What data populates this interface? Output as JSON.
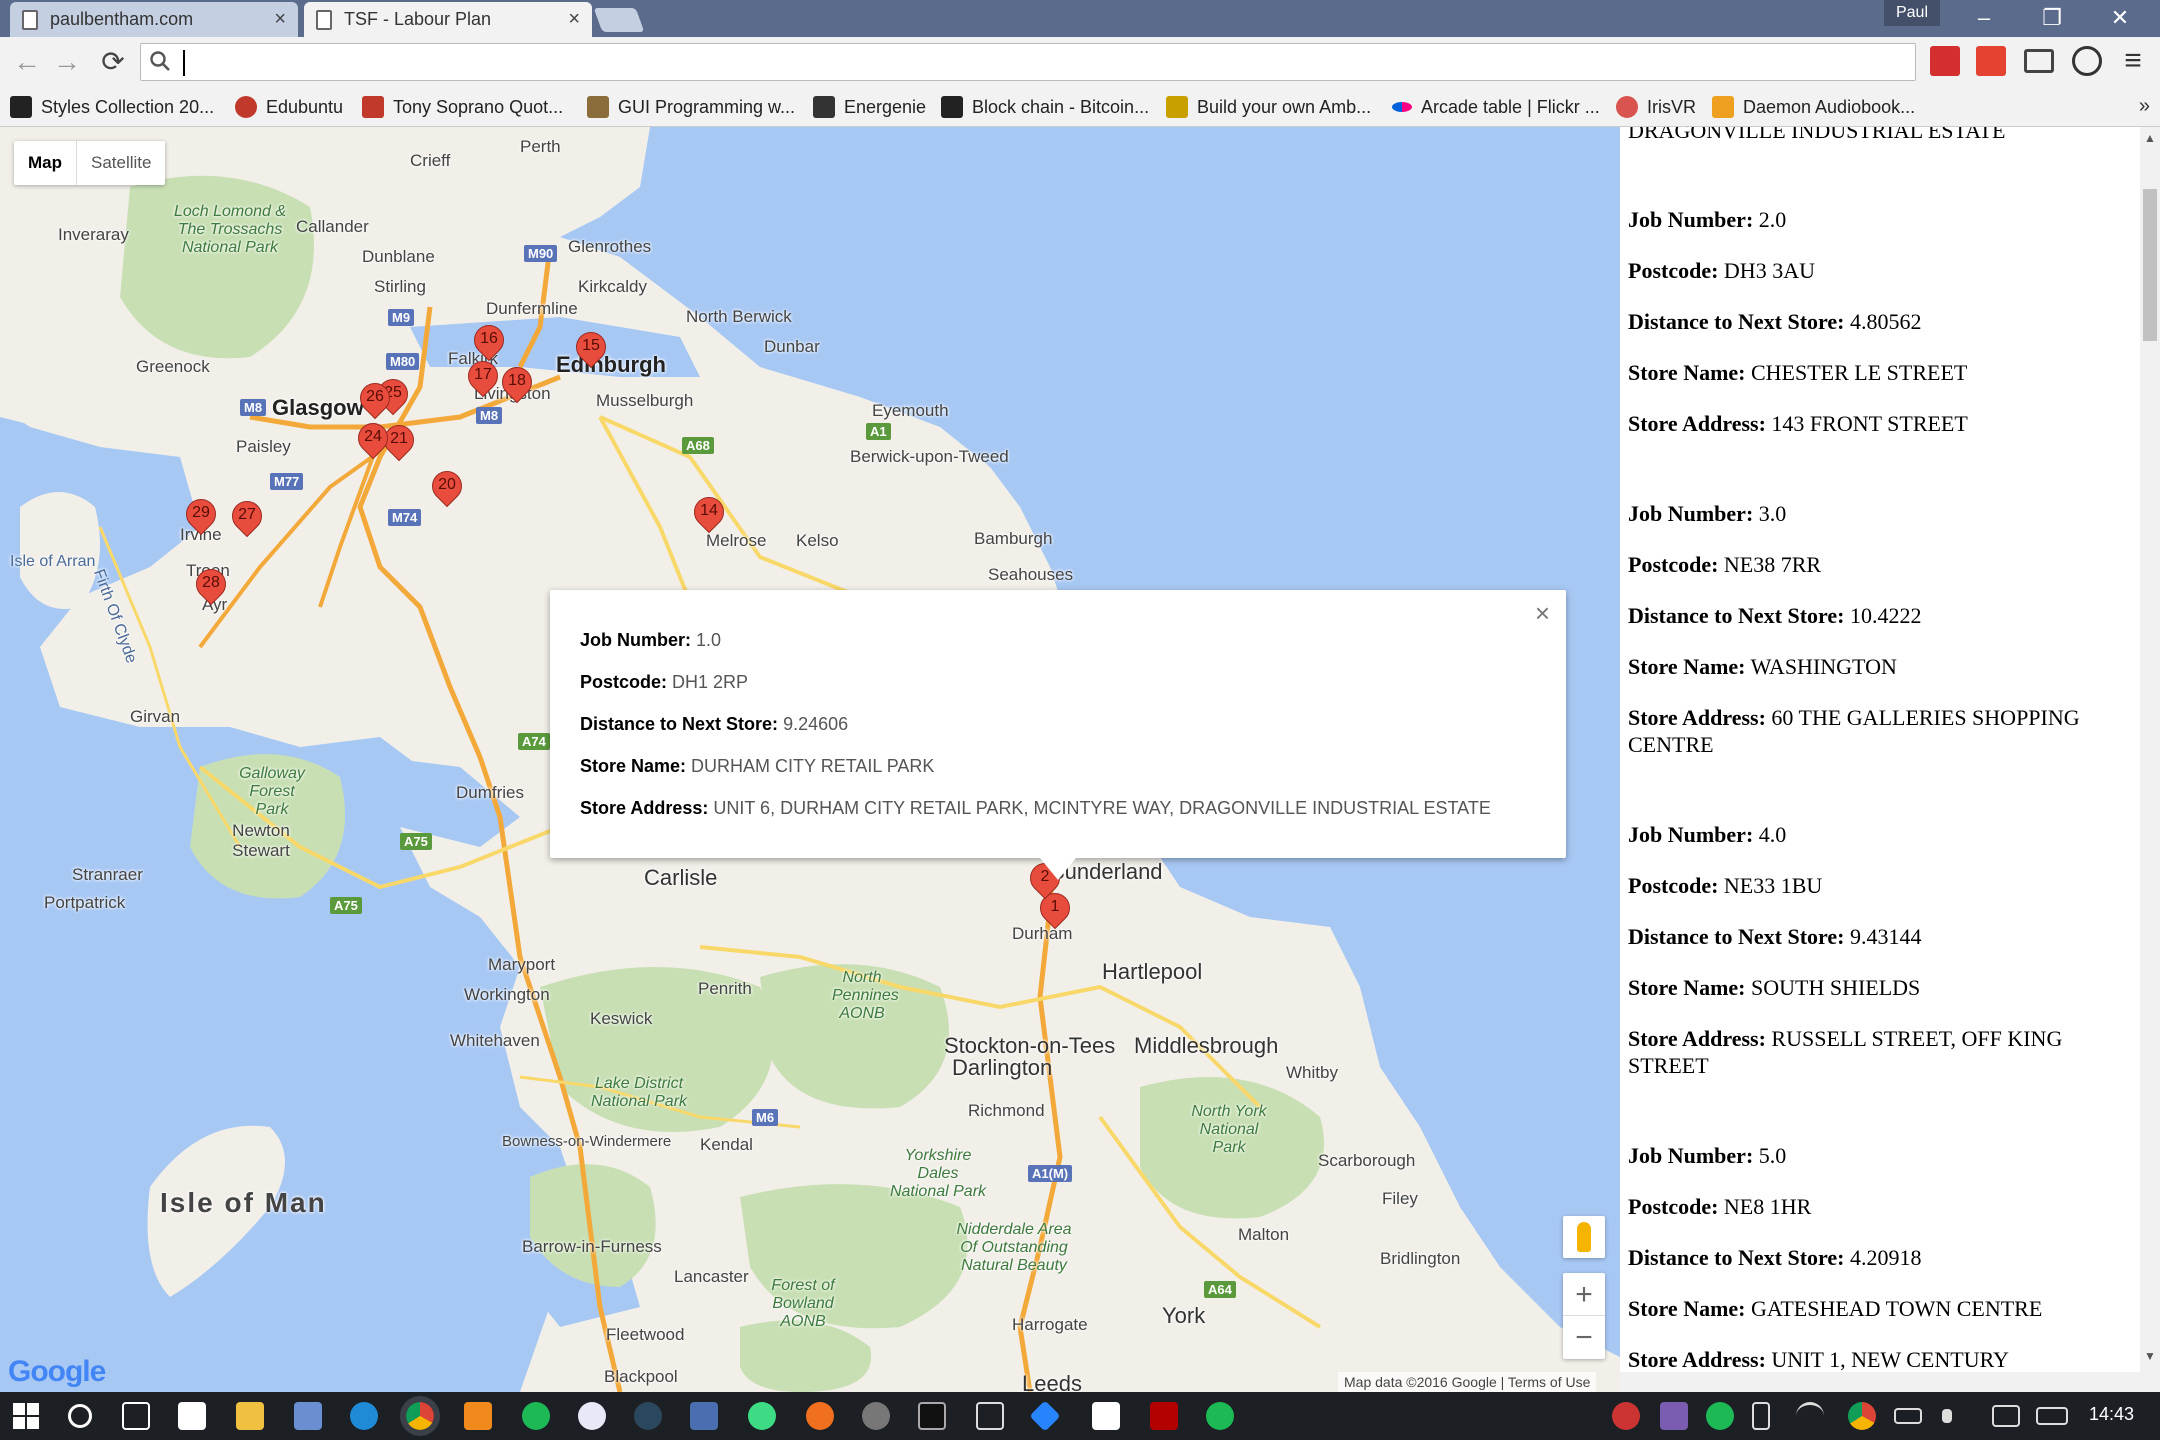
{
  "browser": {
    "tabs": [
      {
        "title": "paulbentham.com",
        "close": "×"
      },
      {
        "title": "TSF - Labour Plan",
        "close": "×"
      }
    ],
    "profile_name": "Paul",
    "window_buttons": {
      "minimize": "–",
      "restore": "❐",
      "close": "✕"
    },
    "nav": {
      "back": "←",
      "forward": "→",
      "reload": "⟳"
    },
    "omnibox": {
      "value": "",
      "search_glyph": "🔍"
    },
    "menu_glyph": "≡",
    "bookmarks": [
      {
        "label": "Styles Collection 20...",
        "icon": "styles-icon",
        "color": "#222222"
      },
      {
        "label": "Edubuntu",
        "icon": "edubuntu-icon",
        "color": "#c0392b"
      },
      {
        "label": "Tony Soprano Quot...",
        "icon": "up-icon",
        "color": "#c0392b"
      },
      {
        "label": "GUI Programming w...",
        "icon": "gui-icon",
        "color": "#8a6d3b"
      },
      {
        "label": "Energenie",
        "icon": "energenie-icon",
        "color": "#333333"
      },
      {
        "label": "Block chain - Bitcoin...",
        "icon": "w-icon",
        "color": "#222222"
      },
      {
        "label": "Build your own Amb...",
        "icon": "build-icon",
        "color": "#c8a000"
      },
      {
        "label": "Arcade table | Flickr ...",
        "icon": "flickr-icon",
        "color": "#ff0084"
      },
      {
        "label": "IrisVR",
        "icon": "irisvr-icon",
        "color": "#d9534f"
      },
      {
        "label": "Daemon Audiobook...",
        "icon": "audible-icon",
        "color": "#f0a020"
      }
    ],
    "bookmarks_overflow": "»"
  },
  "map": {
    "type_controls": {
      "map": "Map",
      "satellite": "Satellite"
    },
    "places": [
      {
        "name": "Perth"
      },
      {
        "name": "Crieff"
      },
      {
        "name": "Loch Lomond & The Trossachs National Park"
      },
      {
        "name": "Inveraray"
      },
      {
        "name": "Callander"
      },
      {
        "name": "Dunblane"
      },
      {
        "name": "Glenrothes"
      },
      {
        "name": "Stirling"
      },
      {
        "name": "Kirkcaldy"
      },
      {
        "name": "Dunfermline"
      },
      {
        "name": "North Berwick"
      },
      {
        "name": "Dunbar"
      },
      {
        "name": "Greenock"
      },
      {
        "name": "Falkirk"
      },
      {
        "name": "Edinburgh"
      },
      {
        "name": "Glasgow"
      },
      {
        "name": "Livingston"
      },
      {
        "name": "Musselburgh"
      },
      {
        "name": "Eyemouth"
      },
      {
        "name": "Paisley"
      },
      {
        "name": "Berwick-upon-Tweed"
      },
      {
        "name": "Irvine"
      },
      {
        "name": "Isle of Arran"
      },
      {
        "name": "Firth Of Clyde"
      },
      {
        "name": "Melrose"
      },
      {
        "name": "Kelso"
      },
      {
        "name": "Bamburgh"
      },
      {
        "name": "Seahouses"
      },
      {
        "name": "Troon"
      },
      {
        "name": "Ayr"
      },
      {
        "name": "Girvan"
      },
      {
        "name": "Galloway Forest Park"
      },
      {
        "name": "Dumfries"
      },
      {
        "name": "Newton Stewart"
      },
      {
        "name": "Stranraer"
      },
      {
        "name": "Portpatrick"
      },
      {
        "name": "Carlisle"
      },
      {
        "name": "Sunderland"
      },
      {
        "name": "Durham"
      },
      {
        "name": "Hartlepool"
      },
      {
        "name": "Maryport"
      },
      {
        "name": "Workington"
      },
      {
        "name": "Penrith"
      },
      {
        "name": "North Pennines AONB"
      },
      {
        "name": "Keswick"
      },
      {
        "name": "Whitehaven"
      },
      {
        "name": "Stockton-on-Tees"
      },
      {
        "name": "Middlesbrough"
      },
      {
        "name": "Darlington"
      },
      {
        "name": "Whitby"
      },
      {
        "name": "Lake District National Park"
      },
      {
        "name": "Richmond"
      },
      {
        "name": "North York National Park"
      },
      {
        "name": "Bowness-on-Windermere"
      },
      {
        "name": "Kendal"
      },
      {
        "name": "Yorkshire Dales National Park"
      },
      {
        "name": "Isle of Man"
      },
      {
        "name": "Scarborough"
      },
      {
        "name": "Filey"
      },
      {
        "name": "Barrow-in-Furness"
      },
      {
        "name": "Nidderdale Area Of Outstanding Natural Beauty"
      },
      {
        "name": "Malton"
      },
      {
        "name": "Bridlington"
      },
      {
        "name": "Lancaster"
      },
      {
        "name": "Forest of Bowland AONB"
      },
      {
        "name": "Harrogate"
      },
      {
        "name": "York"
      },
      {
        "name": "Fleetwood"
      },
      {
        "name": "Blackpool"
      },
      {
        "name": "Leeds"
      }
    ],
    "roads": [
      "M90",
      "M9",
      "M80",
      "M8",
      "M8",
      "M77",
      "M74",
      "A68",
      "A1",
      "A74",
      "A75",
      "A75",
      "M6",
      "A1(M)",
      "A64"
    ],
    "markers": [
      "1",
      "2",
      "14",
      "15",
      "16",
      "17",
      "18",
      "20",
      "21",
      "24",
      "25",
      "26",
      "27",
      "28",
      "29"
    ],
    "info_window": {
      "close": "×",
      "fields": [
        {
          "label": "Job Number:",
          "value": "1.0"
        },
        {
          "label": "Postcode:",
          "value": "DH1 2RP"
        },
        {
          "label": "Distance to Next Store:",
          "value": "9.24606"
        },
        {
          "label": "Store Name:",
          "value": "DURHAM CITY RETAIL PARK"
        },
        {
          "label": "Store Address:",
          "value": "UNIT 6, DURHAM CITY RETAIL PARK, MCINTYRE WAY, DRAGONVILLE INDUSTRIAL ESTATE"
        }
      ]
    },
    "zoom": {
      "in": "+",
      "out": "−"
    },
    "logo": "Google",
    "attribution": "Map data ©2016 Google   |   Terms of Use"
  },
  "panel": {
    "top_fragment": "DRAGONVILLE INDUSTRIAL ESTATE",
    "jobs": [
      {
        "job_label": "Job Number:",
        "job": "2.0",
        "postcode_label": "Postcode:",
        "postcode": "DH3 3AU",
        "distance_label": "Distance to Next Store:",
        "distance": "4.80562",
        "name_label": "Store Name:",
        "name": "CHESTER LE STREET",
        "address_label": "Store Address:",
        "address": "143 FRONT STREET"
      },
      {
        "job_label": "Job Number:",
        "job": "3.0",
        "postcode_label": "Postcode:",
        "postcode": "NE38 7RR",
        "distance_label": "Distance to Next Store:",
        "distance": "10.4222",
        "name_label": "Store Name:",
        "name": "WASHINGTON",
        "address_label": "Store Address:",
        "address": "60 THE GALLERIES SHOPPING CENTRE"
      },
      {
        "job_label": "Job Number:",
        "job": "4.0",
        "postcode_label": "Postcode:",
        "postcode": "NE33 1BU",
        "distance_label": "Distance to Next Store:",
        "distance": "9.43144",
        "name_label": "Store Name:",
        "name": "SOUTH SHIELDS",
        "address_label": "Store Address:",
        "address": "RUSSELL STREET, OFF KING STREET"
      },
      {
        "job_label": "Job Number:",
        "job": "5.0",
        "postcode_label": "Postcode:",
        "postcode": "NE8 1HR",
        "distance_label": "Distance to Next Store:",
        "distance": "4.20918",
        "name_label": "Store Name:",
        "name": "GATESHEAD TOWN CENTRE",
        "address_label": "Store Address:",
        "address": "UNIT 1, NEW CENTURY"
      }
    ]
  },
  "taskbar": {
    "clock": "14:43"
  },
  "colors": {
    "water": "#a8c8f4",
    "land": "#f2efe9",
    "park": "#c8dfb4",
    "motorway": "#f3a93a",
    "road": "#f9d86a",
    "marker": "#e84c3d",
    "tabbar": "#5b6b8c"
  }
}
